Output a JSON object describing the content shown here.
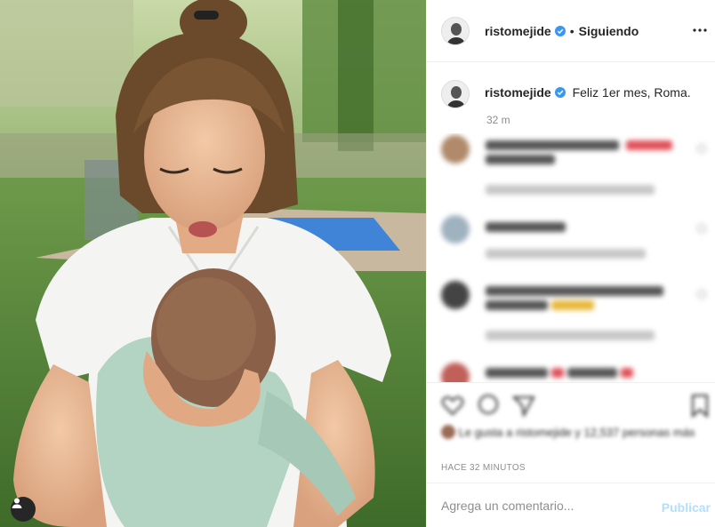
{
  "post": {
    "author": "ristomejide",
    "following_label": "Siguiendo",
    "separator": "•",
    "caption": "Feliz 1er mes, Roma.",
    "caption_age": "32 m",
    "timestamp": "HACE 32 MINUTOS",
    "liked_by_blurred": "Le gusta a ristomejide y 12,537 personas más"
  },
  "comment_box": {
    "placeholder": "Agrega un comentario...",
    "publish_label": "Publicar"
  },
  "colors": {
    "verified": "#3897f0",
    "link_disabled": "#b2dffc",
    "muted": "#8e8e8e"
  }
}
